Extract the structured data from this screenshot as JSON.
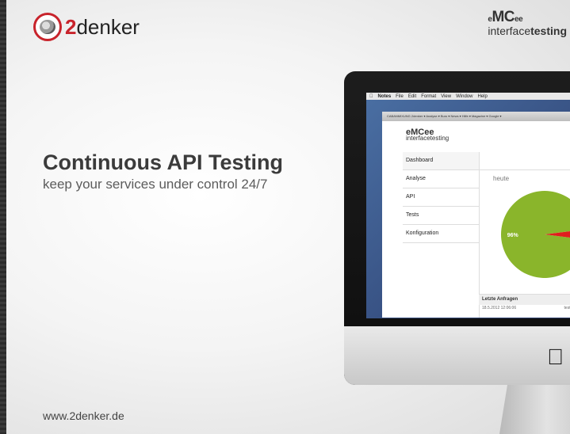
{
  "header": {
    "logo_2": "2",
    "logo_rest": "denker",
    "brand_prefix": "e",
    "brand_mc": "MC",
    "brand_ee": "ee",
    "brand_sub_a": "interface",
    "brand_sub_b": "testing"
  },
  "hero": {
    "headline": "Continuous API Testing",
    "tagline": "keep your services under control 24/7"
  },
  "footer": {
    "url": "www.2denker.de"
  },
  "mac": {
    "menubar": [
      "Notes",
      "File",
      "Edit",
      "Format",
      "View",
      "Window",
      "Help"
    ],
    "bookmarks": "CABANMIXUNG   2denker ▾   Analyse ▾   Buro ▾   News ▾   Hilfe ▾   Magazine ▾   Google ▾",
    "app": {
      "logo_e": "eMCee",
      "logo_sub": "interfacetesting",
      "nav": [
        "Dashboard",
        "Analyse",
        "API",
        "Tests",
        "Konfiguration"
      ],
      "chart_label": "heute",
      "letzte_title": "Letzte Anfragen",
      "row_date": "18.5.2012 12:06:06",
      "row_value": "testRe"
    }
  },
  "chart_data": {
    "type": "pie",
    "categories": [
      "96%",
      "4%"
    ],
    "values": [
      96,
      4
    ],
    "colors": [
      "#8ab52b",
      "#e01e1e"
    ]
  }
}
